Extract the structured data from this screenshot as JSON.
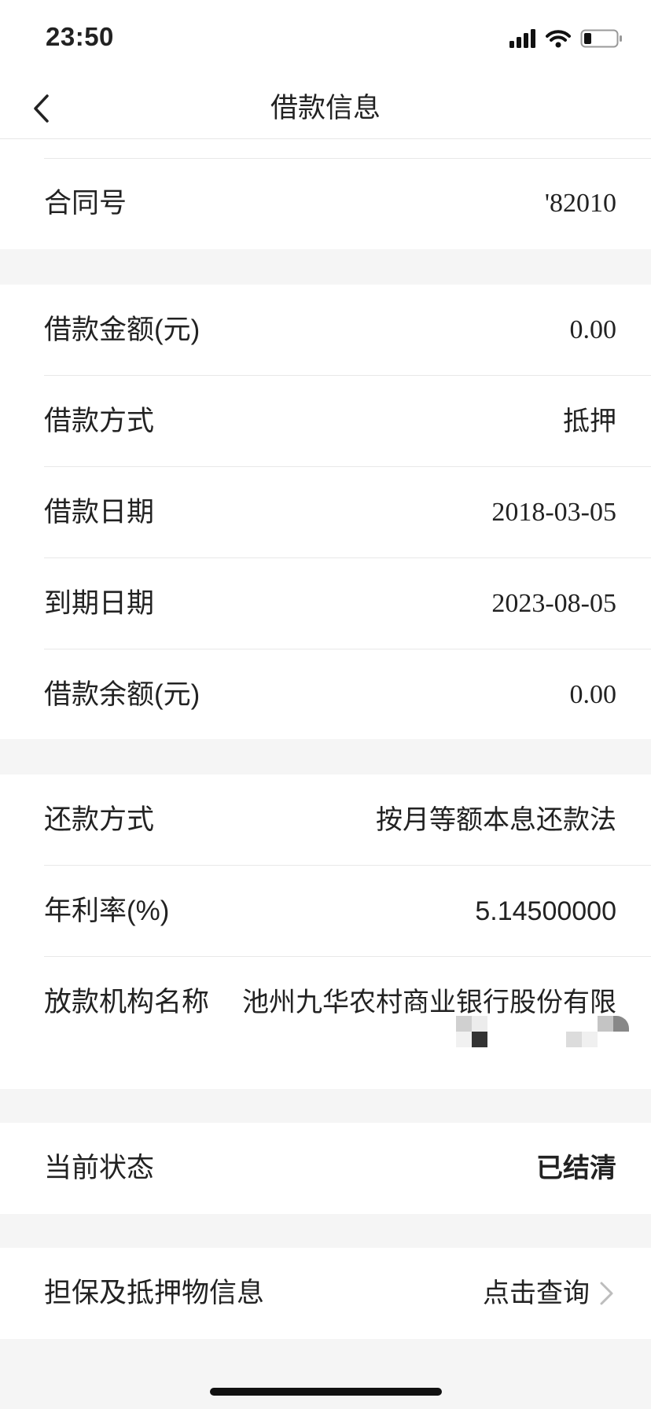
{
  "status_bar": {
    "time": "23:50"
  },
  "nav": {
    "title": "借款信息"
  },
  "contract": {
    "label": "合同号",
    "value": "'82010"
  },
  "loan": {
    "amount_label": "借款金额(元)",
    "amount_value": "0.00",
    "method_label": "借款方式",
    "method_value": "抵押",
    "date_label": "借款日期",
    "date_value": "2018-03-05",
    "due_label": "到期日期",
    "due_value": "2023-08-05",
    "balance_label": "借款余额(元)",
    "balance_value": "0.00"
  },
  "repay": {
    "method_label": "还款方式",
    "method_value": "按月等额本息还款法",
    "rate_label": "年利率(%)",
    "rate_value": "5.14500000",
    "org_label": "放款机构名称",
    "org_value": "池州九华农村商业银行股份有限"
  },
  "status": {
    "label": "当前状态",
    "value": "已结清"
  },
  "guarantee": {
    "label": "担保及抵押物信息",
    "link_text": "点击查询"
  },
  "colors": {
    "accent": "#f29a3b",
    "link_gray": "#b5b5b5"
  }
}
